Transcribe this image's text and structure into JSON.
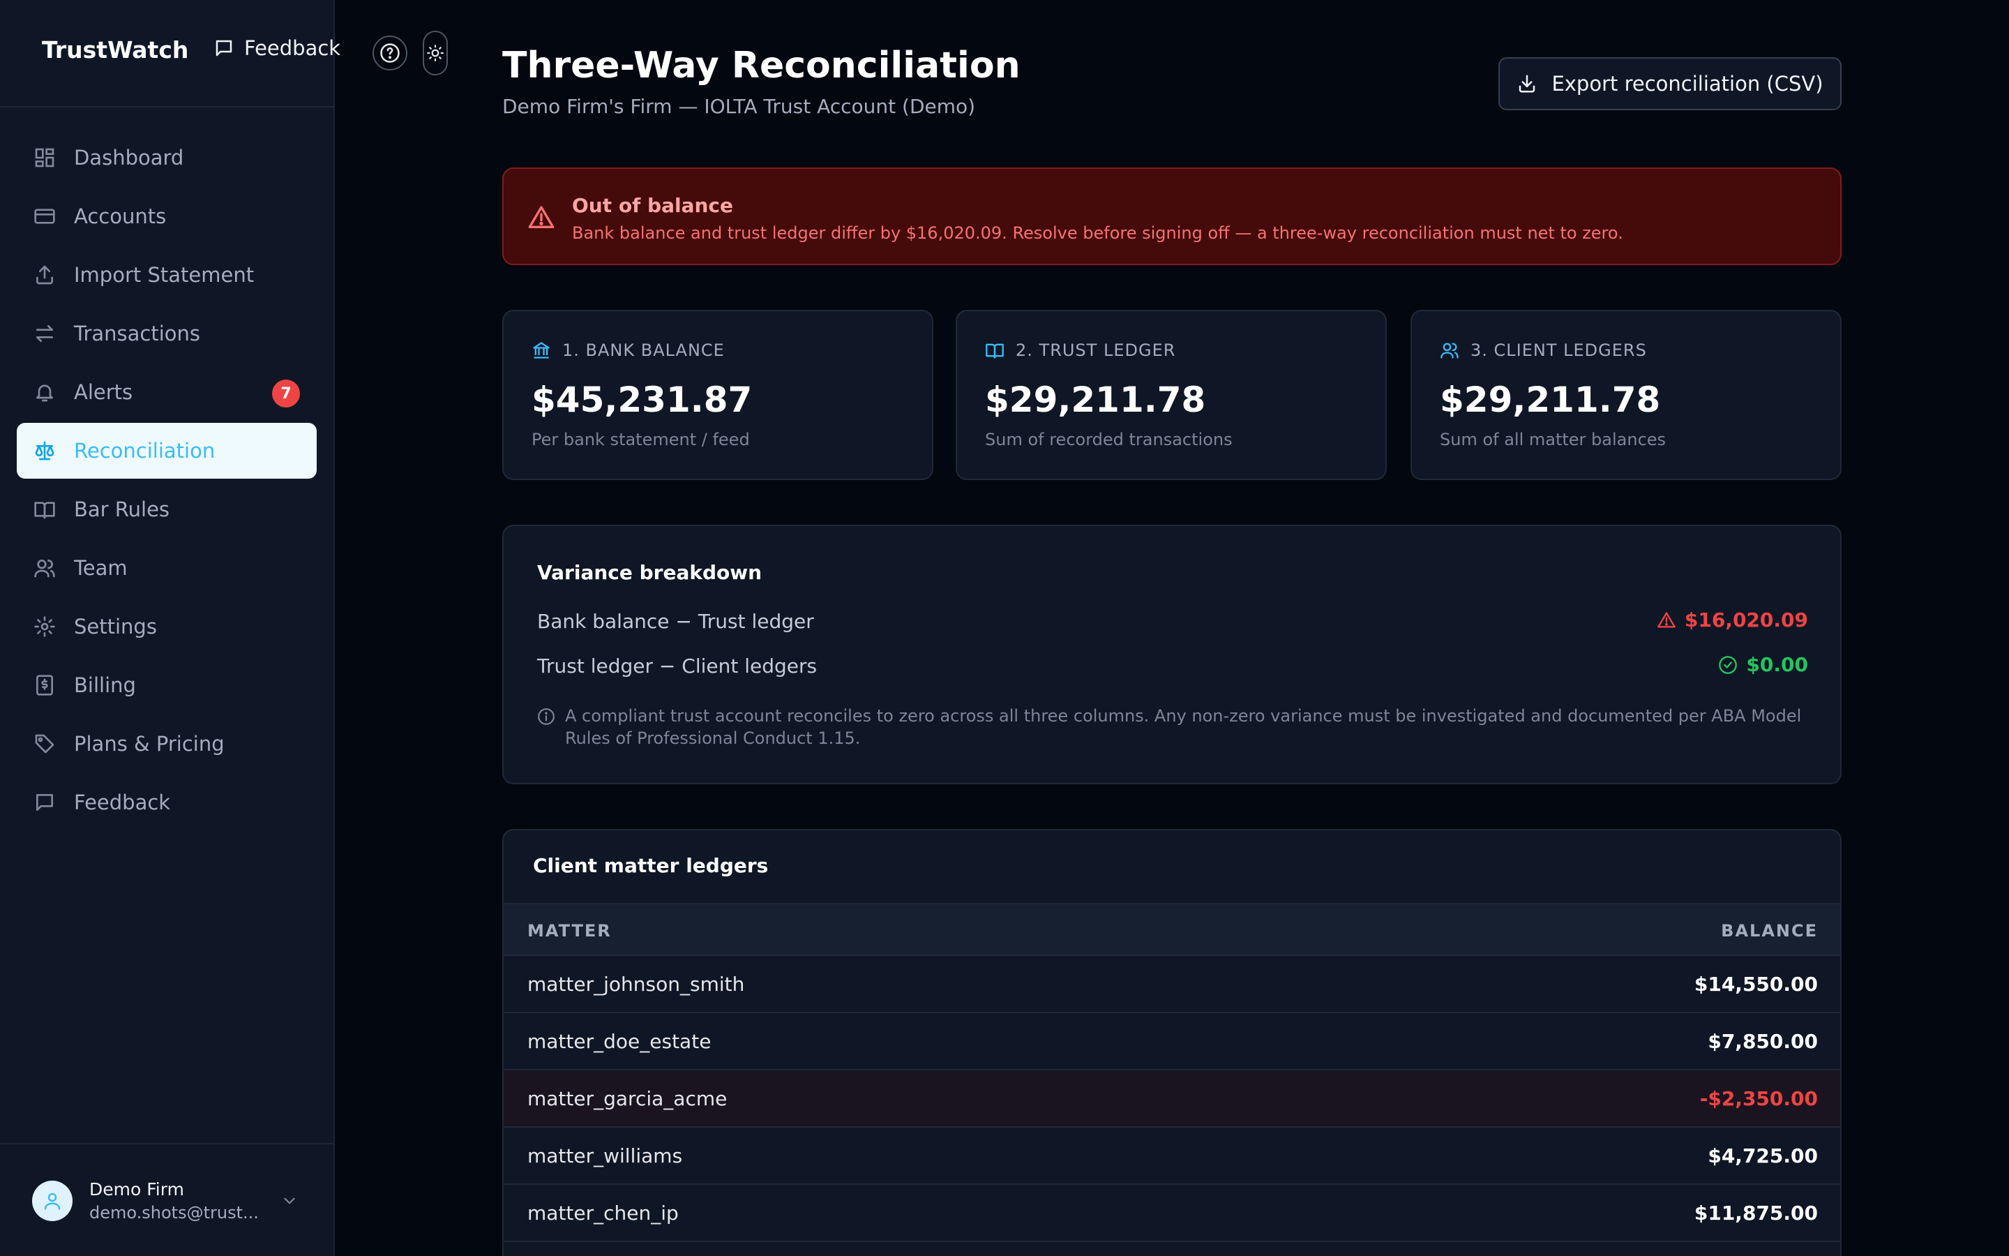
{
  "app": {
    "brand": "TrustWatch",
    "feedback_label": "Feedback"
  },
  "sidebar": {
    "items": [
      {
        "label": "Dashboard",
        "icon": "grid-icon"
      },
      {
        "label": "Accounts",
        "icon": "credit-card-icon"
      },
      {
        "label": "Import Statement",
        "icon": "upload-icon"
      },
      {
        "label": "Transactions",
        "icon": "arrows-swap-icon"
      },
      {
        "label": "Alerts",
        "icon": "bell-icon",
        "badge": "7"
      },
      {
        "label": "Reconciliation",
        "icon": "scale-icon",
        "active": true
      },
      {
        "label": "Bar Rules",
        "icon": "book-open-icon"
      },
      {
        "label": "Team",
        "icon": "users-icon"
      },
      {
        "label": "Settings",
        "icon": "gear-icon"
      },
      {
        "label": "Billing",
        "icon": "receipt-icon"
      },
      {
        "label": "Plans & Pricing",
        "icon": "tag-icon"
      },
      {
        "label": "Feedback",
        "icon": "message-icon"
      }
    ],
    "user": {
      "name": "Demo Firm",
      "email": "demo.shots@trust..."
    }
  },
  "header": {
    "title": "Three-Way Reconciliation",
    "subtitle": "Demo Firm's Firm — IOLTA Trust Account (Demo)",
    "export_label": "Export reconciliation (CSV)"
  },
  "alert": {
    "title": "Out of balance",
    "message": "Bank balance and trust ledger differ by $16,020.09. Resolve before signing off — a three-way reconciliation must net to zero."
  },
  "stats": [
    {
      "label": "1. BANK BALANCE",
      "value": "$45,231.87",
      "caption": "Per bank statement / feed",
      "icon": "bank-icon"
    },
    {
      "label": "2. TRUST LEDGER",
      "value": "$29,211.78",
      "caption": "Sum of recorded transactions",
      "icon": "book-open-icon"
    },
    {
      "label": "3. CLIENT LEDGERS",
      "value": "$29,211.78",
      "caption": "Sum of all matter balances",
      "icon": "users-icon"
    }
  ],
  "variance": {
    "title": "Variance breakdown",
    "rows": [
      {
        "label": "Bank balance − Trust ledger",
        "value": "$16,020.09",
        "status": "bad"
      },
      {
        "label": "Trust ledger − Client ledgers",
        "value": "$0.00",
        "status": "good"
      }
    ],
    "note": "A compliant trust account reconciles to zero across all three columns. Any non-zero variance must be investigated and documented per ABA Model Rules of Professional Conduct 1.15."
  },
  "ledgers": {
    "title": "Client matter ledgers",
    "columns": [
      "MATTER",
      "BALANCE"
    ],
    "rows": [
      {
        "matter": "matter_johnson_smith",
        "balance": "$14,550.00"
      },
      {
        "matter": "matter_doe_estate",
        "balance": "$7,850.00"
      },
      {
        "matter": "matter_garcia_acme",
        "balance": "-$2,350.00",
        "negative": true
      },
      {
        "matter": "matter_williams",
        "balance": "$4,725.00"
      },
      {
        "matter": "matter_chen_ip",
        "balance": "$11,875.00"
      }
    ]
  },
  "colors": {
    "accent": "#38bdf8",
    "danger": "#ef4444",
    "success": "#22c55e",
    "background": "#03070f",
    "panel": "#0f1726"
  }
}
